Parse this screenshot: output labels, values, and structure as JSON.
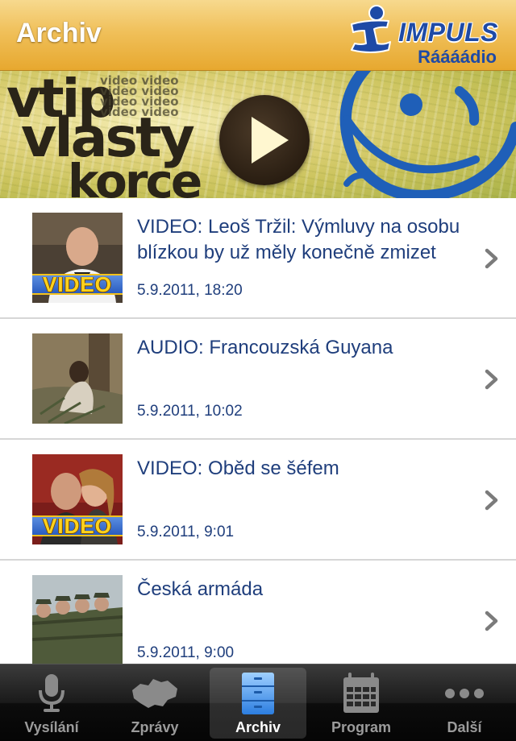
{
  "header": {
    "title": "Archiv",
    "logo_name": "IMPULS",
    "logo_sub": "Ráááádio"
  },
  "banner": {
    "line1": "vtip",
    "line2": "vlasty",
    "line3": "korce",
    "video_words": "video video video video video video video video",
    "play_icon": "play-icon"
  },
  "articles": [
    {
      "title": "VIDEO: Leoš Tržil: Výmluvy na osobu blízkou by už měly konečně zmizet",
      "date": "5.9.2011, 18:20",
      "badge": "VIDEO"
    },
    {
      "title": "AUDIO: Francouzská Guyana",
      "date": "5.9.2011, 10:02",
      "badge": ""
    },
    {
      "title": "VIDEO: Oběd se šéfem",
      "date": "5.9.2011, 9:01",
      "badge": "VIDEO"
    },
    {
      "title": "Česká armáda",
      "date": "5.9.2011, 9:00",
      "badge": ""
    }
  ],
  "tabs": [
    {
      "label": "Vysílání",
      "icon": "microphone-icon"
    },
    {
      "label": "Zprávy",
      "icon": "map-icon"
    },
    {
      "label": "Archiv",
      "icon": "archive-cabinet-icon",
      "active": true
    },
    {
      "label": "Program",
      "icon": "calendar-icon"
    },
    {
      "label": "Další",
      "icon": "more-dots-icon"
    }
  ],
  "colors": {
    "header_gold": "#f0c05a",
    "text_blue": "#1f3e7c",
    "logo_blue": "#1e4aa6",
    "badge_yellow": "#ffd21c"
  }
}
